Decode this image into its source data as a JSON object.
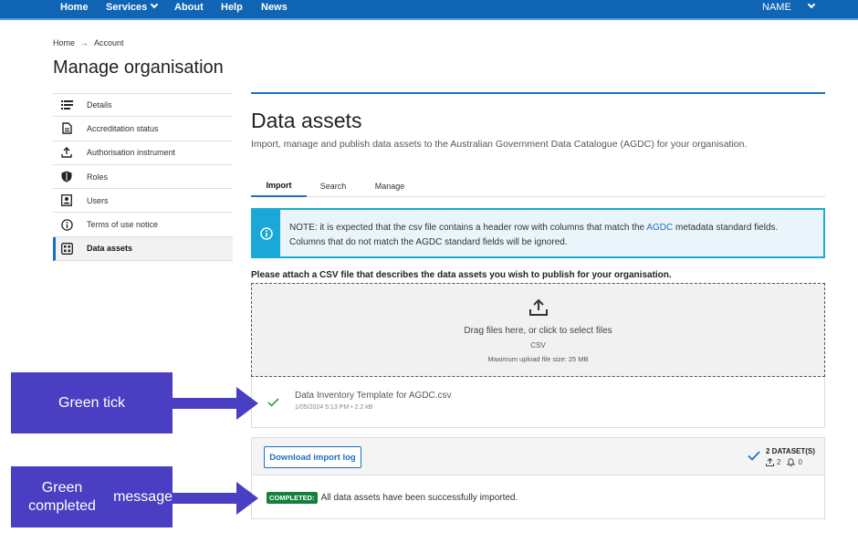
{
  "nav": {
    "items": [
      "Home",
      "Services",
      "About",
      "Help",
      "News"
    ],
    "user": "NAME"
  },
  "breadcrumb": {
    "home": "Home",
    "current": "Account"
  },
  "page": {
    "title": "Manage organisation"
  },
  "sidebar": {
    "items": [
      {
        "label": "Details",
        "icon": "list-icon"
      },
      {
        "label": "Accreditation status",
        "icon": "document-icon"
      },
      {
        "label": "Authorisation instrument",
        "icon": "upload-icon"
      },
      {
        "label": "Roles",
        "icon": "shield-icon"
      },
      {
        "label": "Users",
        "icon": "user-card-icon"
      },
      {
        "label": "Terms of use notice",
        "icon": "info-icon"
      },
      {
        "label": "Data assets",
        "icon": "grid-icon",
        "active": true
      }
    ]
  },
  "main": {
    "title": "Data assets",
    "subtitle": "Import, manage and publish data assets to the Australian Government Data Catalogue (AGDC) for your organisation.",
    "tabs": [
      "Import",
      "Search",
      "Manage"
    ],
    "notice": {
      "pre": "NOTE: it is expected that the csv file contains a header row with columns that match the ",
      "link": "AGDC",
      "post": " metadata standard fields.",
      "line2": "Columns that do not match the AGDC standard fields will be ignored."
    },
    "attach_label": "Please attach a CSV file that describes the data assets you wish to publish for your organisation.",
    "dropzone": {
      "text": "Drag files here, or click to select files",
      "type": "CSV",
      "max": "Maximum upload file size: 25 MB"
    },
    "file": {
      "name": "Data Inventory Template for AGDC.csv",
      "meta": "1/05/2024 5:13 PM  •  2.2 kB"
    },
    "result": {
      "download_label": "Download import log",
      "dataset_count": "2 DATASET(S)",
      "uploaded": "2",
      "alerts": "0",
      "badge": "COMPLETED:",
      "message": "All data assets have been successfully imported."
    }
  },
  "annotations": {
    "green_tick": "Green tick",
    "completed_message_line1": "Green completed",
    "completed_message_line2": "message"
  },
  "colors": {
    "nav_bg": "#0f64b4",
    "accent": "#1d6fc3",
    "notice": "#1aa8d8",
    "success": "#15803d",
    "callout": "#4a3fc2"
  }
}
